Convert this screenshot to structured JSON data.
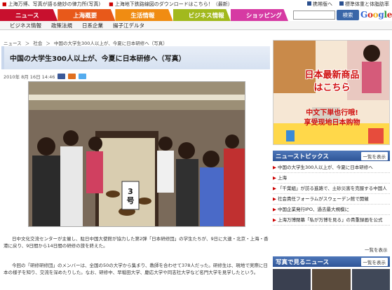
{
  "ticker": {
    "items": [
      "上海万博、写真が語る絶妙の律力所(写真)",
      "上海地下鉄路線図のダウンロードはこちら！（最新）"
    ],
    "right_links": [
      "携帯版へ",
      "標準体重と体脂肪率"
    ]
  },
  "nav": {
    "tabs": [
      {
        "label": "ニュース",
        "color": "#c8102e"
      },
      {
        "label": "上海概要",
        "color": "#e8591a"
      },
      {
        "label": "生活情報",
        "color": "#f08c12"
      },
      {
        "label": "ビジネス情報",
        "color": "#a2b91d"
      },
      {
        "label": "ショッピング",
        "color": "#d63aa3"
      }
    ],
    "search_button": "検索",
    "search_logo": "Google"
  },
  "subnav": {
    "items": [
      "ビジネス情報",
      "政策法規",
      "日系企業",
      "揚子江デルタ"
    ]
  },
  "breadcrumb": [
    "ニュース",
    "＞",
    "社会",
    "＞",
    "中国の大学生300人以上が、今夏に日本研修へ（写真）"
  ],
  "article": {
    "title": "中国の大学生300人以上が、今夏に日本研修へ（写真）",
    "datetime": "2010年 8月 16日 14:46",
    "paragraph1": "日中文化交流センターが主催し、駐日中国大使館が協力した第2弾「日本研修団」の学生たちが、9日に大連・北京・上海・香港に戻り、9日間から14日間の研修の旅を終えた。",
    "paragraph2": "今回の「研修研修団」のメンバーは、全国の50の大学から集まり、教師を合わせて378人だった。研修生は、現地で実際に日本の様子を知り、交流を深めたりした。なお、研修中、早稲田大学、慶応大学や同志社大学など名門大学を見学したという。",
    "table_sign": "3号"
  },
  "ad": {
    "line1": "日本最新商品",
    "line2": "はこちら",
    "line3": "中文下単也行哦!",
    "line4": "享受现地日本购物"
  },
  "topics": {
    "heading": "ニューストピックス",
    "more_label": "一覧を表示",
    "items": [
      "中国の大学生300人以上が、今夏に日本研修へ",
      "上海",
      "「千葉組」が訪る進路で、土砂災害を克服する中国人",
      "社会責任フォーラムがスウェーデン館で開催",
      "中国企業発行IPO、過去最大規模に",
      "上海万博閉幕「私が万博を見る」の貴重録画を公式"
    ],
    "more_bottom": "一覧を表示"
  },
  "photo_news": {
    "heading": "写真で見るニュース",
    "more_label": "一覧を表示"
  },
  "colors": {
    "primary_blue": "#2f5597",
    "ad_red": "#d01010"
  }
}
